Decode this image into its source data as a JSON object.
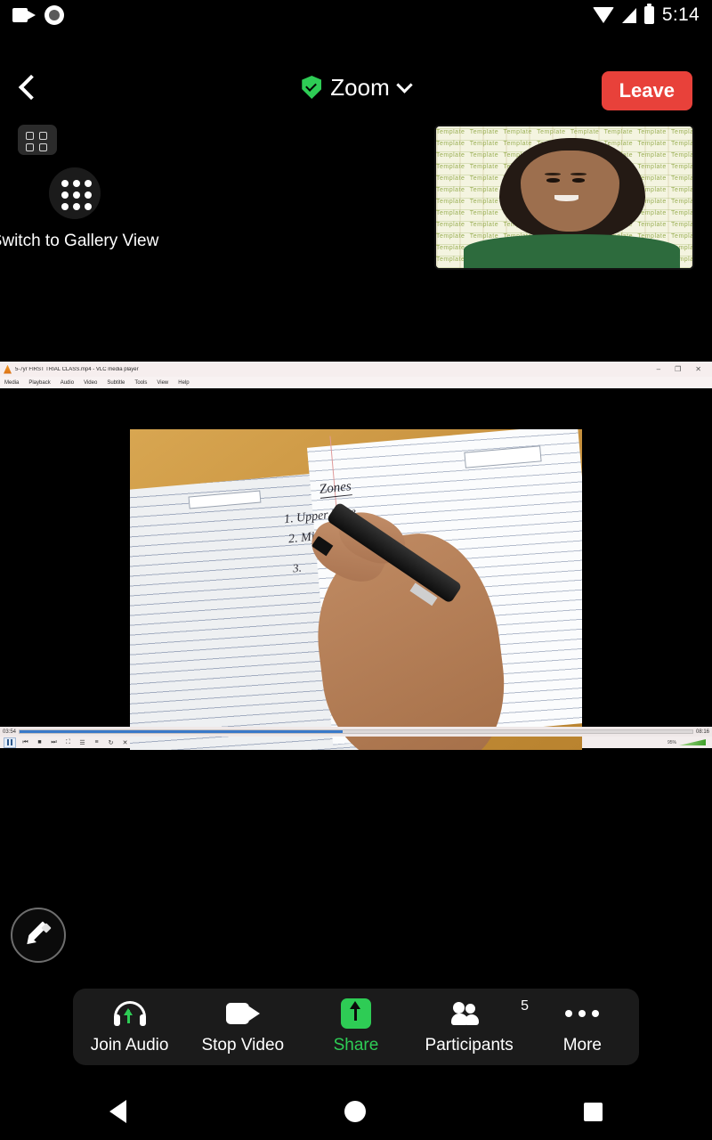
{
  "status_bar": {
    "time": "5:14",
    "icons": [
      "camera-recording-icon",
      "screen-record-icon",
      "wifi-icon",
      "cellular-signal-icon",
      "battery-icon"
    ]
  },
  "top_bar": {
    "back_icon": "chevron-left-icon",
    "security_icon": "green-shield-check-icon",
    "title": "Zoom",
    "dropdown_icon": "chevron-down-icon",
    "leave_label": "Leave"
  },
  "view_controls": {
    "toggle_icon": "four-dot-grid-icon",
    "gallery_icon": "nine-dot-grid-icon",
    "gallery_label": "Switch to Gallery View"
  },
  "self_view": {
    "label": "self-video-thumbnail",
    "description": "woman in green shirt on patterned virtual background"
  },
  "shared_screen": {
    "app_title": "5-7yr FIRST TRIAL CLASS.mp4 - VLC media player",
    "menu_items": [
      "Media",
      "Playback",
      "Audio",
      "Video",
      "Subtitle",
      "Tools",
      "View",
      "Help"
    ],
    "window_buttons": {
      "minimize": "–",
      "maximize": "❐",
      "close": "✕"
    },
    "elapsed_time": "03:54",
    "total_time": "08:16",
    "progress_percent": 48,
    "volume_percent": "95%",
    "video_content": {
      "title_word": "Zones",
      "line_1": "1. Upper Zone",
      "line_2": "2. Middle Zone",
      "line_3": "3."
    }
  },
  "annotate": {
    "icon": "pencil-icon"
  },
  "toolbar": {
    "items": [
      {
        "label": "Join Audio",
        "icon": "headset-audio-icon",
        "accent": false,
        "badge": ""
      },
      {
        "label": "Stop Video",
        "icon": "video-camera-icon",
        "accent": false,
        "badge": ""
      },
      {
        "label": "Share",
        "icon": "share-screen-icon",
        "accent": true,
        "badge": ""
      },
      {
        "label": "Participants",
        "icon": "people-icon",
        "accent": false,
        "badge": "5"
      },
      {
        "label": "More",
        "icon": "more-dots-icon",
        "accent": false,
        "badge": ""
      }
    ]
  },
  "nav_bar": {
    "back": "back-triangle-icon",
    "home": "home-circle-icon",
    "recents": "recents-square-icon"
  },
  "colors": {
    "leave_red": "#e8413a",
    "accent_green": "#2ecc55",
    "background": "#000000",
    "toolbar_bg": "#1b1b1b"
  }
}
